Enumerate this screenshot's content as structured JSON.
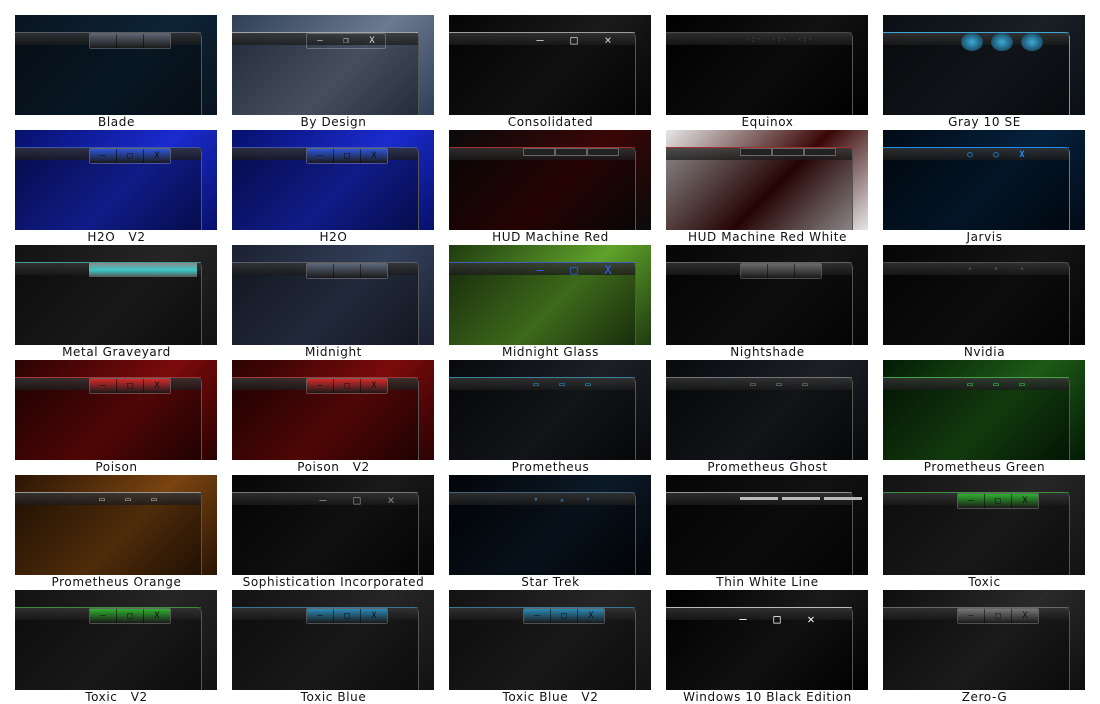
{
  "themes": [
    {
      "label": "Blade",
      "colors": [
        "#0a1420",
        "#0d2436"
      ],
      "accent": "#5a6470",
      "buttons": "bars",
      "glyphs": [
        "",
        "",
        ""
      ]
    },
    {
      "label": "By Design",
      "colors": [
        "#2f3f55",
        "#6b7a90"
      ],
      "accent": "#d8d8d8",
      "buttons": "light",
      "glyphs": [
        "—",
        "❐",
        "X"
      ]
    },
    {
      "label": "Consolidated",
      "colors": [
        "#050505",
        "#1a1a1a"
      ],
      "accent": "#cfcfcf",
      "buttons": "plain",
      "glyphs": [
        "–",
        "□",
        "×"
      ]
    },
    {
      "label": "Equinox",
      "colors": [
        "#000000",
        "#121212"
      ],
      "accent": "#444444",
      "buttons": "dots",
      "glyphs": [
        "·:·",
        "·:·",
        "·:·"
      ]
    },
    {
      "label": "Gray 10 SE",
      "colors": [
        "#0a0f14",
        "#1a1f26"
      ],
      "accent": "#3fa9d6",
      "buttons": "orbs",
      "glyphs": [
        "",
        "",
        ""
      ]
    },
    {
      "label": "H2O   V2",
      "colors": [
        "#07106a",
        "#1a2bd0"
      ],
      "accent": "#2e56d8",
      "buttons": "bars",
      "glyphs": [
        "—",
        "□",
        "X"
      ]
    },
    {
      "label": "H2O",
      "colors": [
        "#07106a",
        "#1a2bd0"
      ],
      "accent": "#2e56d8",
      "buttons": "bars",
      "glyphs": [
        "—",
        "□",
        "X"
      ]
    },
    {
      "label": "HUD Machine Red",
      "colors": [
        "#0a0a0a",
        "#3a0606"
      ],
      "accent": "#d41818",
      "buttons": "slots",
      "glyphs": [
        "",
        "",
        ""
      ]
    },
    {
      "label": "HUD Machine Red White",
      "colors": [
        "#e6e6e6",
        "#3a0606"
      ],
      "accent": "#d41818",
      "buttons": "slots",
      "glyphs": [
        "",
        "",
        ""
      ]
    },
    {
      "label": "Jarvis",
      "colors": [
        "#020a16",
        "#06213c"
      ],
      "accent": "#1d8ef0",
      "buttons": "rings",
      "glyphs": [
        "○",
        "○",
        "X"
      ]
    },
    {
      "label": "Metal Graveyard",
      "colors": [
        "#121212",
        "#262626"
      ],
      "accent": "#3cc8c8",
      "buttons": "pill",
      "glyphs": [
        "",
        "",
        ""
      ]
    },
    {
      "label": "Midnight",
      "colors": [
        "#1a2030",
        "#34405a"
      ],
      "accent": "#5c6678",
      "buttons": "bars",
      "glyphs": [
        "",
        "",
        ""
      ]
    },
    {
      "label": "Midnight Glass",
      "colors": [
        "#1f3a10",
        "#5fa22a"
      ],
      "accent": "#2e62ff",
      "buttons": "plain",
      "glyphs": [
        "—",
        "□",
        "X"
      ]
    },
    {
      "label": "Nightshade",
      "colors": [
        "#050505",
        "#151515"
      ],
      "accent": "#6a6a6a",
      "buttons": "bars",
      "glyphs": [
        "",
        "",
        ""
      ]
    },
    {
      "label": "Nvidia",
      "colors": [
        "#050505",
        "#141414"
      ],
      "accent": "#4a4a4a",
      "buttons": "dots",
      "glyphs": [
        "•",
        "•",
        "•"
      ]
    },
    {
      "label": "Poison",
      "colors": [
        "#2a0303",
        "#7a0a0a"
      ],
      "accent": "#d42a2a",
      "buttons": "bars",
      "glyphs": [
        "—",
        "□",
        "X"
      ]
    },
    {
      "label": "Poison   V2",
      "colors": [
        "#2a0303",
        "#7a0a0a"
      ],
      "accent": "#d42a2a",
      "buttons": "bars",
      "glyphs": [
        "—",
        "□",
        "X"
      ]
    },
    {
      "label": "Prometheus",
      "colors": [
        "#07090c",
        "#1c2026"
      ],
      "accent": "#2aa0d0",
      "buttons": "glyph",
      "glyphs": [
        "▭",
        "▭",
        "▭"
      ]
    },
    {
      "label": "Prometheus Ghost",
      "colors": [
        "#07090c",
        "#1c2026"
      ],
      "accent": "#888888",
      "buttons": "glyph",
      "glyphs": [
        "▭",
        "▭",
        "▭"
      ]
    },
    {
      "label": "Prometheus Green",
      "colors": [
        "#031a05",
        "#1d5a16"
      ],
      "accent": "#3cd43c",
      "buttons": "glyph",
      "glyphs": [
        "▭",
        "▭",
        "▭"
      ]
    },
    {
      "label": "Prometheus Orange",
      "colors": [
        "#2a1404",
        "#7a4410"
      ],
      "accent": "#c0c0c0",
      "buttons": "glyph",
      "glyphs": [
        "▭",
        "▭",
        "▭"
      ]
    },
    {
      "label": "Sophistication Incorporated",
      "colors": [
        "#050505",
        "#1a1a1a"
      ],
      "accent": "#888888",
      "buttons": "plain",
      "glyphs": [
        "—",
        "□",
        "×"
      ]
    },
    {
      "label": "Star Trek",
      "colors": [
        "#020408",
        "#0c1a28"
      ],
      "accent": "#3a6a88",
      "buttons": "tabs",
      "glyphs": [
        "▾",
        "▴",
        "▾"
      ]
    },
    {
      "label": "Thin White Line",
      "colors": [
        "#050505",
        "#121212"
      ],
      "accent": "#bbbbbb",
      "buttons": "lines",
      "glyphs": [
        "",
        "",
        ""
      ]
    },
    {
      "label": "Toxic",
      "colors": [
        "#121212",
        "#262626"
      ],
      "accent": "#2fb02f",
      "buttons": "bars",
      "glyphs": [
        "—",
        "□",
        "X"
      ]
    },
    {
      "label": "Toxic   V2",
      "colors": [
        "#121212",
        "#262626"
      ],
      "accent": "#2fb02f",
      "buttons": "bars",
      "glyphs": [
        "—",
        "□",
        "X"
      ]
    },
    {
      "label": "Toxic Blue",
      "colors": [
        "#121212",
        "#262626"
      ],
      "accent": "#2a8ab6",
      "buttons": "bars",
      "glyphs": [
        "—",
        "□",
        "X"
      ]
    },
    {
      "label": "Toxic Blue   V2",
      "colors": [
        "#121212",
        "#262626"
      ],
      "accent": "#2a8ab6",
      "buttons": "bars",
      "glyphs": [
        "—",
        "□",
        "X"
      ]
    },
    {
      "label": "Windows 10 Black Edition",
      "colors": [
        "#000000",
        "#1a1a1a"
      ],
      "accent": "#ffffff",
      "buttons": "win10",
      "glyphs": [
        "—",
        "□",
        "✕"
      ]
    },
    {
      "label": "Zero-G",
      "colors": [
        "#0e0e0e",
        "#2a2a2a"
      ],
      "accent": "#777777",
      "buttons": "bars",
      "glyphs": [
        "—",
        "□",
        "X"
      ]
    }
  ]
}
